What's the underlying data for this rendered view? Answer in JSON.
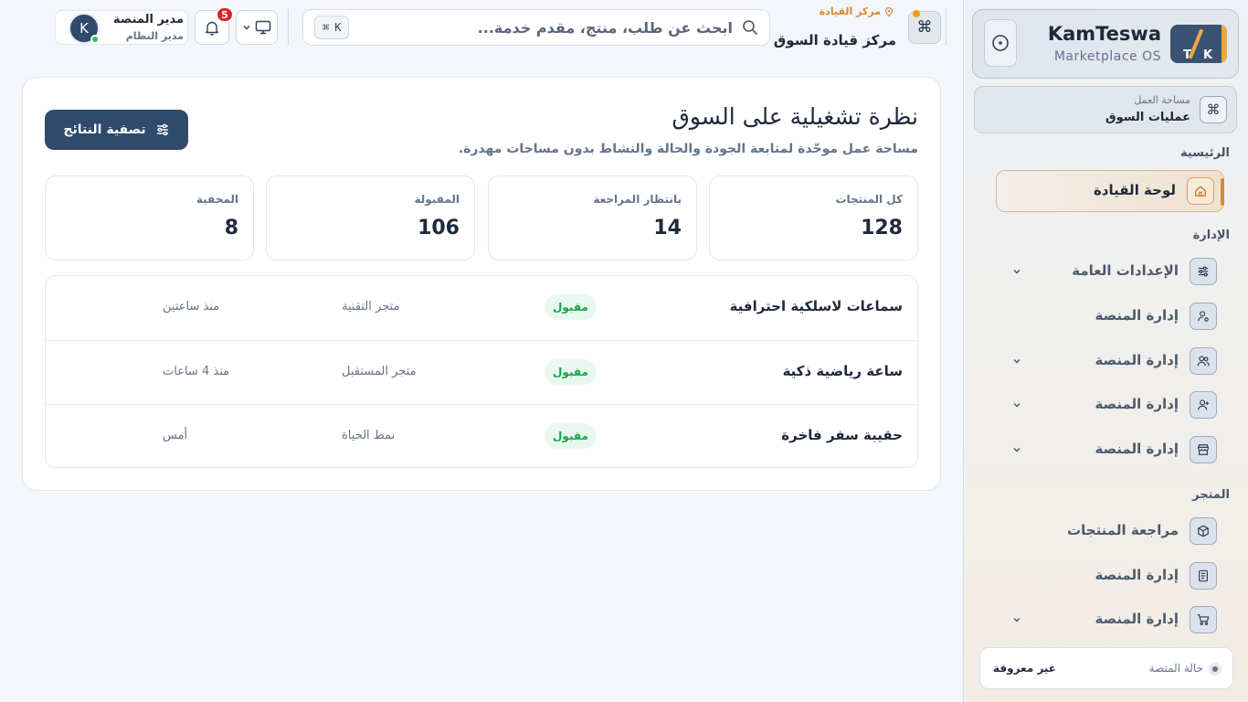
{
  "colors": {
    "primary": "#2f4a6b",
    "accent": "#d7893a",
    "success": "#16a34a",
    "danger": "#dc2626"
  },
  "sidebar": {
    "brand": {
      "name": "KamTeswa",
      "subtitle": "Marketplace OS",
      "logo_letters": [
        "T",
        "K"
      ]
    },
    "workspace": {
      "label": "مساحة العمل",
      "value": "عمليات السوق",
      "icon": "command-icon"
    },
    "sections": {
      "main": "الرئيسية",
      "admin": "الإدارة",
      "store": "المتجر"
    },
    "items": [
      {
        "label": "لوحة القيادة",
        "icon": "home-icon",
        "active": true
      },
      {
        "label": "الإعدادات العامة",
        "icon": "sliders-icon",
        "has_children": true
      },
      {
        "label": "إدارة المنصة",
        "icon": "user-cog-icon",
        "has_children": false
      },
      {
        "label": "إدارة المنصة",
        "icon": "users-icon",
        "has_children": true
      },
      {
        "label": "إدارة المنصة",
        "icon": "user-plus-icon",
        "has_children": true
      },
      {
        "label": "إدارة المنصة",
        "icon": "store-icon",
        "has_children": true
      },
      {
        "label": "مراجعة المنتجات",
        "icon": "box-icon",
        "has_children": false
      },
      {
        "label": "إدارة المنصة",
        "icon": "document-icon",
        "has_children": false
      },
      {
        "label": "إدارة المنصة",
        "icon": "cart-icon",
        "has_children": true
      }
    ],
    "status": {
      "label": "حالة المنصة",
      "value": "غير معروفة"
    }
  },
  "header": {
    "breadcrumb": "مركز القيادة",
    "title": "مركز قيادة السوق",
    "search": {
      "placeholder": "ابحث عن طلب، منتج، مقدم خدمة...",
      "value": "",
      "shortcut_symbol": "⌘",
      "shortcut_key": "K"
    },
    "notifications_count": "5",
    "user": {
      "name": "مدير المنصة",
      "role": "مدير النظام",
      "initial": "K"
    }
  },
  "main": {
    "title": "نظرة تشغيلية على السوق",
    "subtitle": "مساحة عمل موحّدة لمتابعة الجودة والحالة والنشاط بدون مساحات مهدرة.",
    "filter_label": "تصفية النتائج",
    "stats": [
      {
        "label": "كل المنتجات",
        "value": "128"
      },
      {
        "label": "بانتظار المراجعة",
        "value": "14"
      },
      {
        "label": "المقبولة",
        "value": "106"
      },
      {
        "label": "المخفية",
        "value": "8"
      }
    ],
    "rows": [
      {
        "name": "سماعات لاسلكية احترافية",
        "status": "مقبول",
        "store": "متجر التقنية",
        "time": "منذ ساعتين"
      },
      {
        "name": "ساعة رياضية ذكية",
        "status": "مقبول",
        "store": "متجر المستقبل",
        "time": "منذ 4 ساعات"
      },
      {
        "name": "حقيبة سفر فاخرة",
        "status": "مقبول",
        "store": "نمط الحياة",
        "time": "أمس"
      }
    ]
  }
}
